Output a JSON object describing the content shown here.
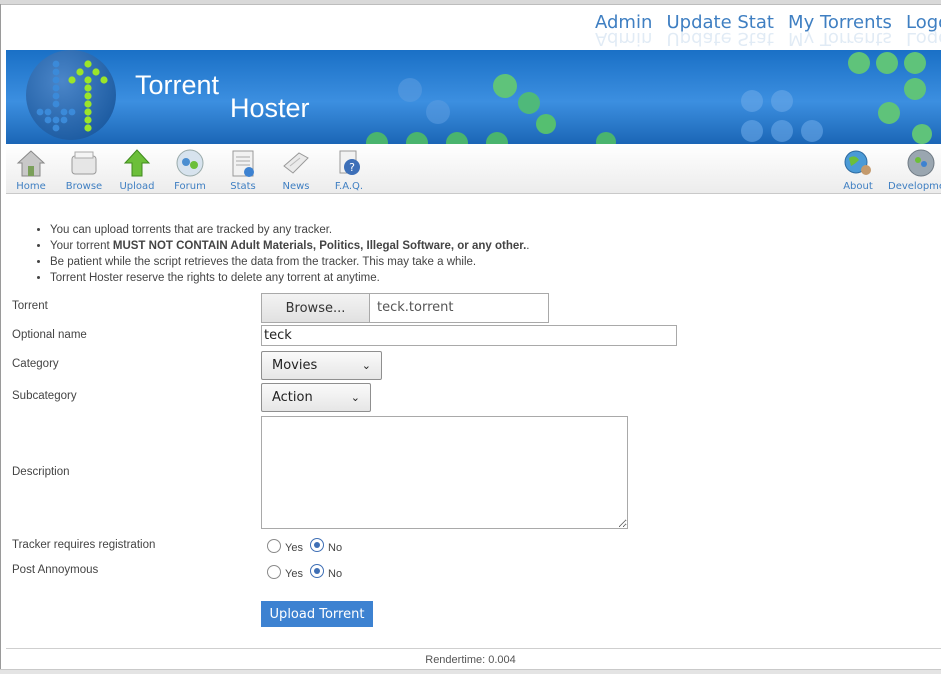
{
  "top_links": [
    "Admin",
    "Update Stat",
    "My Torrents",
    "Logout"
  ],
  "brand": {
    "line1": "Torrent",
    "line2": "Hoster"
  },
  "toolbar": {
    "left": [
      "Home",
      "Browse",
      "Upload",
      "Forum",
      "Stats",
      "News",
      "F.A.Q."
    ],
    "right": [
      "About",
      "Development"
    ]
  },
  "notes": {
    "n1": "You can upload torrents that are tracked by any tracker.",
    "n2_prefix": "Your torrent ",
    "n2_bold": "MUST NOT CONTAIN Adult Materials, Politics, Illegal Software, or any other.",
    "n2_suffix": ".",
    "n3": "Be patient while the script retrieves the data from the tracker. This may take a while.",
    "n4": "Torrent Hoster reserve the rights to delete any torrent at anytime."
  },
  "form": {
    "torrent_label": "Torrent",
    "browse_label": "Browse...",
    "file_name": "teck.torrent",
    "optional_name_label": "Optional name",
    "optional_name_value": "teck",
    "category_label": "Category",
    "category_value": "Movies",
    "subcategory_label": "Subcategory",
    "subcategory_value": "Action",
    "description_label": "Description",
    "description_value": "",
    "tracker_reg_label": "Tracker requires registration",
    "tracker_reg_selected": "No",
    "post_anon_label": "Post Annoymous",
    "post_anon_selected": "No",
    "yes": "Yes",
    "no": "No",
    "submit_label": "Upload Torrent"
  },
  "footer": {
    "rendertime": "Rendertime: 0.004"
  },
  "colors": {
    "link": "#3f7fc2",
    "banner": "#1a70c6",
    "button": "#3d82d1",
    "logo_dots": "#9be52a"
  }
}
